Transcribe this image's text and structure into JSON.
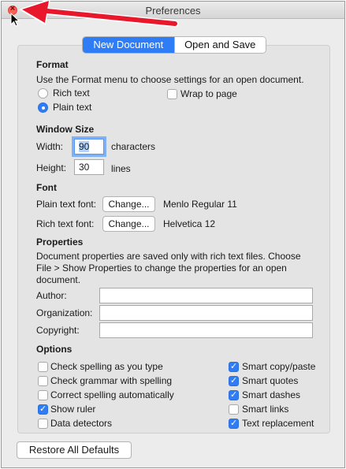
{
  "window": {
    "title": "Preferences"
  },
  "tabs": {
    "new_document": "New Document",
    "open_and_save": "Open and Save"
  },
  "format": {
    "heading": "Format",
    "description": "Use the Format menu to choose settings for an open document.",
    "rich_text": "Rich text",
    "plain_text": "Plain text",
    "wrap_to_page": "Wrap to page"
  },
  "window_size": {
    "heading": "Window Size",
    "width_label": "Width:",
    "width_value": "90",
    "width_unit": "characters",
    "height_label": "Height:",
    "height_value": "30",
    "height_unit": "lines"
  },
  "font": {
    "heading": "Font",
    "plain_label": "Plain text font:",
    "plain_change": "Change...",
    "plain_value": "Menlo Regular 11",
    "rich_label": "Rich text font:",
    "rich_change": "Change...",
    "rich_value": "Helvetica 12"
  },
  "properties": {
    "heading": "Properties",
    "desc1": "Document properties are saved only with rich text files. Choose",
    "desc2": "File > Show Properties to change the properties for an open",
    "desc3": "document.",
    "author": "Author:",
    "organization": "Organization:",
    "copyright": "Copyright:"
  },
  "options": {
    "heading": "Options",
    "check_spelling": "Check spelling as you type",
    "check_grammar": "Check grammar with spelling",
    "correct_spelling": "Correct spelling automatically",
    "show_ruler": "Show ruler",
    "data_detectors": "Data detectors",
    "smart_copy": "Smart copy/paste",
    "smart_quotes": "Smart quotes",
    "smart_dashes": "Smart dashes",
    "smart_links": "Smart links",
    "text_replacement": "Text replacement"
  },
  "restore_label": "Restore All Defaults",
  "icons": {
    "close": "close-icon",
    "arrow": "red-arrow-icon",
    "cursor": "cursor-icon"
  }
}
